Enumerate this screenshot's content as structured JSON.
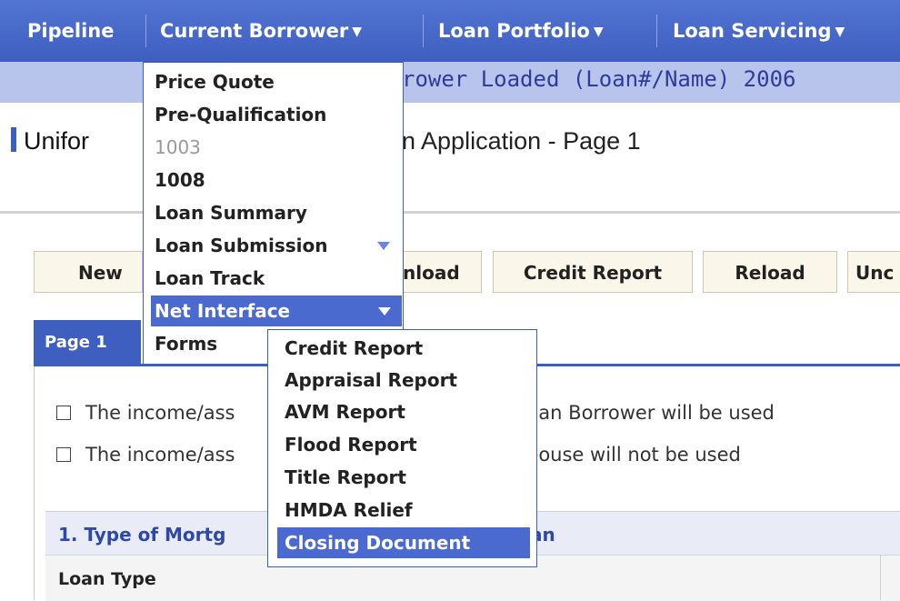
{
  "nav": {
    "items": [
      {
        "label": "Pipeline",
        "caret": ""
      },
      {
        "label": "Current Borrower",
        "caret": "▼"
      },
      {
        "label": "Loan Portfolio",
        "caret": "▼"
      },
      {
        "label": "Loan Servicing",
        "caret": "▼"
      }
    ]
  },
  "status": {
    "text": "rower Loaded (Loan#/Name) 2006"
  },
  "page": {
    "title_start": "Unifor",
    "title_end": "n Application - Page 1"
  },
  "toolbar": {
    "new_label": "New",
    "download_label": "nload",
    "credit_report_label": "Credit Report",
    "reload_label": "Reload",
    "undo_label": "Unc"
  },
  "tabs": {
    "page1_label": "Page 1"
  },
  "form": {
    "check1_start": "The income/ass",
    "check1_end": "han Borrower will be used",
    "check2_start": "The income/ass",
    "check2_end": "pouse will not be used",
    "section_title_start": "1. Type of Mortg",
    "section_title_end": "an",
    "loan_type_label": "Loan Type"
  },
  "menu": {
    "items": [
      {
        "label": "Price Quote",
        "state": "normal",
        "submenu": false
      },
      {
        "label": "Pre-Qualification",
        "state": "normal",
        "submenu": false
      },
      {
        "label": "1003",
        "state": "disabled",
        "submenu": false
      },
      {
        "label": "1008",
        "state": "normal",
        "submenu": false
      },
      {
        "label": "Loan Summary",
        "state": "normal",
        "submenu": false
      },
      {
        "label": "Loan Submission",
        "state": "normal",
        "submenu": true
      },
      {
        "label": "Loan Track",
        "state": "normal",
        "submenu": false
      },
      {
        "label": "Net Interface",
        "state": "highlighted",
        "submenu": true
      },
      {
        "label": "Forms",
        "state": "normal",
        "submenu": false
      }
    ]
  },
  "submenu": {
    "items": [
      {
        "label": "Credit Report",
        "state": "normal"
      },
      {
        "label": "Appraisal Report",
        "state": "normal"
      },
      {
        "label": "AVM Report",
        "state": "normal"
      },
      {
        "label": "Flood Report",
        "state": "normal"
      },
      {
        "label": "Title Report",
        "state": "normal"
      },
      {
        "label": "HMDA Relief",
        "state": "normal"
      },
      {
        "label": "Closing Document",
        "state": "highlighted"
      }
    ]
  },
  "colors": {
    "brand": "#3e5fc0",
    "highlight": "#4b6ad0",
    "status_bg": "#b8c4ec"
  }
}
